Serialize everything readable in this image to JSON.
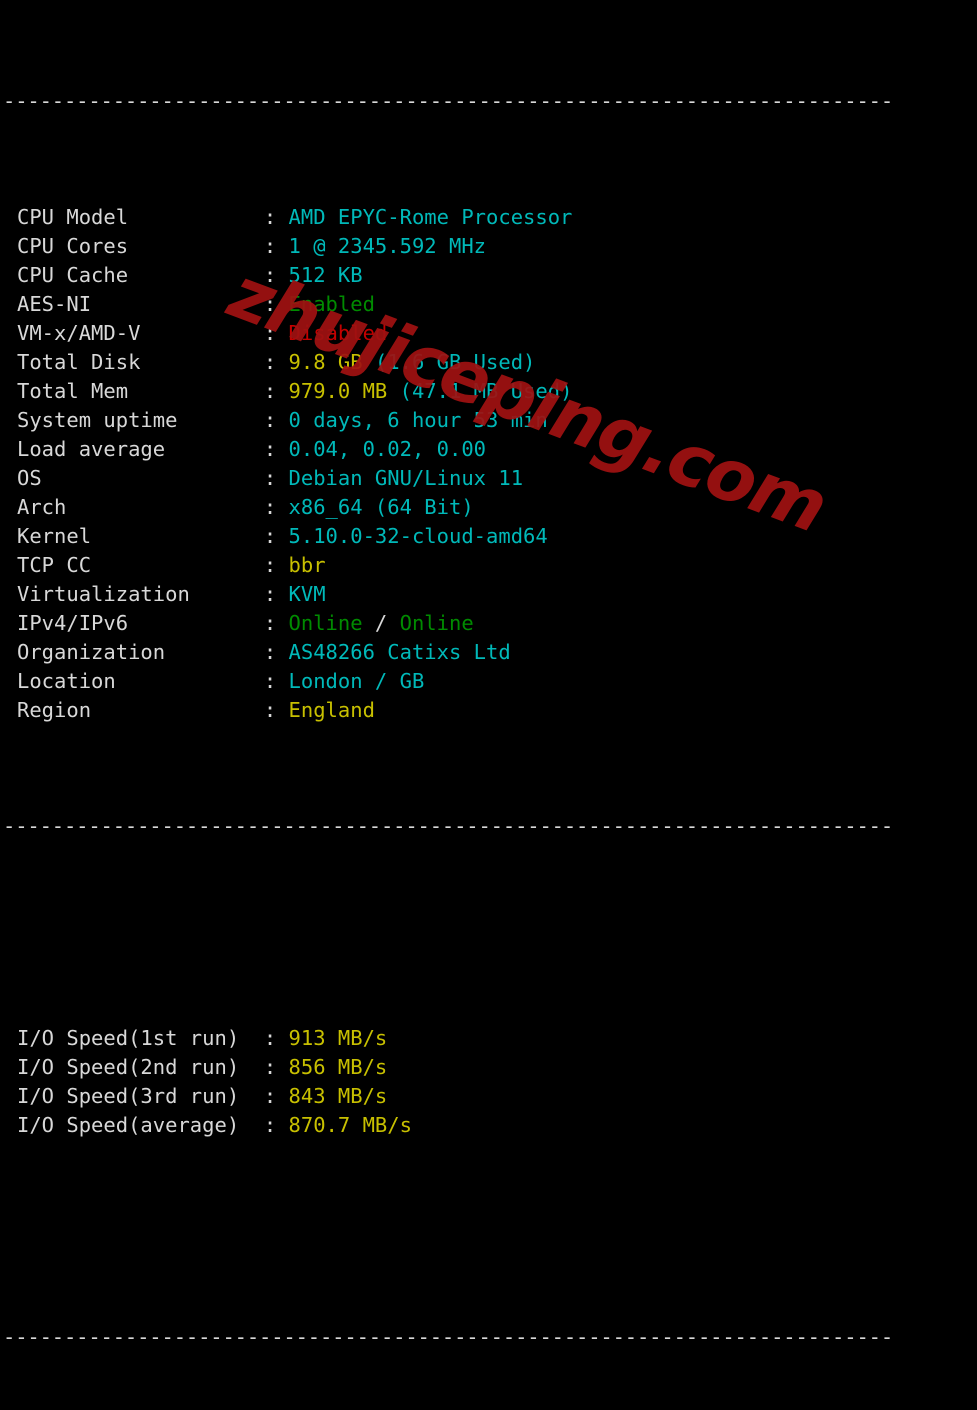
{
  "terminal": {
    "background_color": "#000000",
    "separator_top": "-------------------------------------------------------------------------",
    "separator_mid": "-------------------------------------------------------------------------",
    "separator_bottom": "-------------------------------------------------------------------------",
    "colon": ":",
    "colors": {
      "label": "#d8d8d8",
      "cyan": "#00b9b9",
      "yellow": "#c8c000",
      "green": "#008b00",
      "red": "#c40000",
      "white": "#d8d8d8",
      "watermark": "#a01212"
    },
    "sysinfo": [
      {
        "label": "CPU Model",
        "segments": [
          {
            "text": "AMD EPYC-Rome Processor",
            "color": "cyan"
          }
        ]
      },
      {
        "label": "CPU Cores",
        "segments": [
          {
            "text": "1 @ 2345.592 MHz",
            "color": "cyan"
          }
        ]
      },
      {
        "label": "CPU Cache",
        "segments": [
          {
            "text": "512 KB",
            "color": "cyan"
          }
        ]
      },
      {
        "label": "AES-NI",
        "segments": [
          {
            "text": "Enabled",
            "color": "green"
          }
        ]
      },
      {
        "label": "VM-x/AMD-V",
        "segments": [
          {
            "text": "Disabled",
            "color": "red"
          }
        ]
      },
      {
        "label": "Total Disk",
        "segments": [
          {
            "text": "9.8 GB ",
            "color": "yellow"
          },
          {
            "text": "(1.6 GB Used)",
            "color": "cyan"
          }
        ]
      },
      {
        "label": "Total Mem",
        "segments": [
          {
            "text": "979.0 MB ",
            "color": "yellow"
          },
          {
            "text": "(47.1 MB Used)",
            "color": "cyan"
          }
        ]
      },
      {
        "label": "System uptime",
        "segments": [
          {
            "text": "0 days, 6 hour 53 min",
            "color": "cyan"
          }
        ]
      },
      {
        "label": "Load average",
        "segments": [
          {
            "text": "0.04, 0.02, 0.00",
            "color": "cyan"
          }
        ]
      },
      {
        "label": "OS",
        "segments": [
          {
            "text": "Debian GNU/Linux 11",
            "color": "cyan"
          }
        ]
      },
      {
        "label": "Arch",
        "segments": [
          {
            "text": "x86_64 (64 Bit)",
            "color": "cyan"
          }
        ]
      },
      {
        "label": "Kernel",
        "segments": [
          {
            "text": "5.10.0-32-cloud-amd64",
            "color": "cyan"
          }
        ]
      },
      {
        "label": "TCP CC",
        "segments": [
          {
            "text": "bbr",
            "color": "yellow"
          }
        ]
      },
      {
        "label": "Virtualization",
        "segments": [
          {
            "text": "KVM",
            "color": "cyan"
          }
        ]
      },
      {
        "label": "IPv4/IPv6",
        "segments": [
          {
            "text": "Online",
            "color": "green"
          },
          {
            "text": " / ",
            "color": "white"
          },
          {
            "text": "Online",
            "color": "green"
          }
        ]
      },
      {
        "label": "Organization",
        "segments": [
          {
            "text": "AS48266 Catixs Ltd",
            "color": "cyan"
          }
        ]
      },
      {
        "label": "Location",
        "segments": [
          {
            "text": "London / GB",
            "color": "cyan"
          }
        ]
      },
      {
        "label": "Region",
        "segments": [
          {
            "text": "England",
            "color": "yellow"
          }
        ]
      }
    ],
    "iospeed": [
      {
        "label": "I/O Speed(1st run)",
        "segments": [
          {
            "text": "913 MB/s",
            "color": "yellow"
          }
        ]
      },
      {
        "label": "I/O Speed(2nd run)",
        "segments": [
          {
            "text": "856 MB/s",
            "color": "yellow"
          }
        ]
      },
      {
        "label": "I/O Speed(3rd run)",
        "segments": [
          {
            "text": "843 MB/s",
            "color": "yellow"
          }
        ]
      },
      {
        "label": "I/O Speed(average)",
        "segments": [
          {
            "text": "870.7 MB/s",
            "color": "yellow"
          }
        ]
      }
    ]
  },
  "watermark": {
    "text": "zhujiceping.com"
  }
}
